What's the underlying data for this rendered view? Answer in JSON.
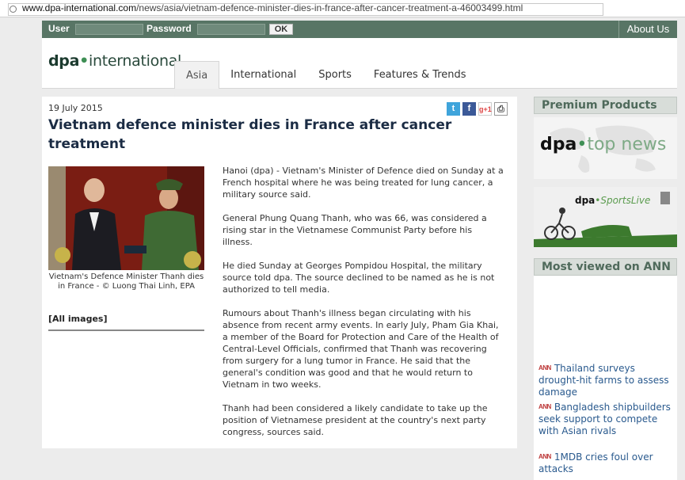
{
  "browser": {
    "url_domain": "www.dpa-international.com",
    "url_path": "/news/asia/vietnam-defence-minister-dies-in-france-after-cancer-treatment-a-46003499.html"
  },
  "topbar": {
    "user_label": "User",
    "password_label": "Password",
    "ok_label": "OK",
    "about_label": "About Us"
  },
  "header": {
    "logo_dpa": "dpa",
    "logo_dot": "•",
    "logo_rest": "international",
    "tabs": [
      {
        "label": "Asia"
      },
      {
        "label": "International"
      },
      {
        "label": "Sports"
      },
      {
        "label": "Features & Trends"
      }
    ]
  },
  "article": {
    "date": "19 July 2015",
    "headline": "Vietnam defence minister dies in France after cancer treatment",
    "caption": "Vietnam's Defence Minister Thanh dies in France - © Luong Thai Linh, EPA",
    "all_images": "[All images]",
    "share": {
      "twitter": "t",
      "facebook": "f",
      "gplus": "g+1",
      "print": "⎙"
    },
    "paragraphs": [
      "Hanoi (dpa) - Vietnam's Minister of Defence died on Sunday at a French hospital where he was being treated for lung cancer, a military source said.",
      "General Phung Quang Thanh, who was 66, was considered a rising star in the Vietnamese Communist Party before his illness.",
      "He died Sunday at Georges Pompidou Hospital, the military source told dpa. The source declined to be named as he is not authorized to tell media.",
      "Rumours about Thanh's illness began circulating with his absence from recent army events. In early July, Pham Gia Khai, a member of the Board for Protection and Care of the Health of Central-Level Officials, confirmed that Thanh was recovering from surgery for a lung tumor in France. He said that the general's condition was good and that he would return to Vietnam in two weeks.",
      "Thanh had been considered a likely candidate to take up the position of Vietnamese president at the country's next party congress, sources said."
    ]
  },
  "sidebar": {
    "premium_heading": "Premium Products",
    "topnews": {
      "dpa": "dpa",
      "dot": "•",
      "rest": "top news"
    },
    "sportslive": {
      "dpa": "dpa",
      "dot": "•",
      "rest": "SportsLive"
    },
    "most_viewed_heading": "Most viewed on ANN",
    "ann_logo": "ANN",
    "ann_items": [
      {
        "title": "Thailand surveys drought-hit farms to assess damage"
      },
      {
        "title": "Bangladesh shipbuilders seek support to compete with Asian rivals"
      },
      {
        "title": "1MDB cries foul over attacks"
      }
    ]
  },
  "colors": {
    "topbar_green": "#587565",
    "headline_navy": "#1b2c44",
    "logo_green": "#3f8f55",
    "link_blue": "#2a5a8e",
    "sidebar_heading_bg": "#d8ddd9"
  }
}
